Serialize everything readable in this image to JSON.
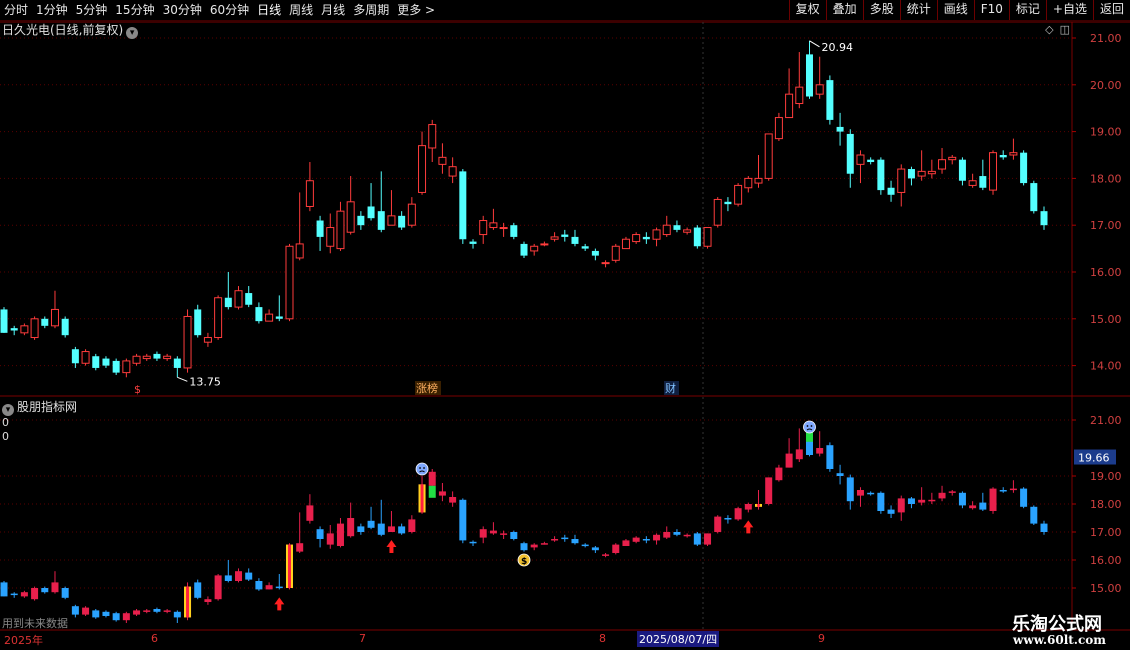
{
  "toolbar": {
    "periods": [
      "分时",
      "1分钟",
      "5分钟",
      "15分钟",
      "30分钟",
      "60分钟",
      "日线",
      "周线",
      "月线",
      "多周期",
      "更多 >"
    ],
    "active_period": "日线",
    "actions": [
      "复权",
      "叠加",
      "多股",
      "统计",
      "画线",
      "F10",
      "标记",
      "+自选",
      "返回"
    ]
  },
  "stock": {
    "title": "日久光电(日线,前复权)"
  },
  "indicator": {
    "title": "股朋指标网"
  },
  "zeros": [
    "0",
    "0"
  ],
  "main_pane": {
    "y_ticks": [
      "21.00",
      "20.00",
      "19.00",
      "18.00",
      "17.00",
      "16.00",
      "15.00",
      "14.00"
    ],
    "high_label": "20.94",
    "low_label": "13.75",
    "markers": [
      "$",
      "涨榜",
      "财"
    ]
  },
  "sub_pane": {
    "y_ticks": [
      "21.00",
      "19.00",
      "18.00",
      "17.00",
      "16.00",
      "15.00"
    ],
    "current_price": "19.66"
  },
  "dates": [
    "2025年",
    "6",
    "7",
    "8",
    "9"
  ],
  "cursor_date": "2025/08/07/四",
  "future_note": "用到未来数据",
  "watermark": {
    "name": "乐淘公式网",
    "url": "www.60lt.com"
  },
  "colors": {
    "up": "#ff3c3c",
    "down": "#54ffff",
    "sub_up": "#e8204c",
    "sub_down": "#2aa3ff",
    "grid": "#5a0000"
  },
  "chart_data": {
    "type": "candlestick",
    "y_range": [
      13.6,
      21.2
    ],
    "candles": [
      [
        15.2,
        14.7,
        15.25,
        14.7
      ],
      [
        14.8,
        14.75,
        14.85,
        14.65
      ],
      [
        14.7,
        14.85,
        14.9,
        14.65
      ],
      [
        14.6,
        15.0,
        15.05,
        14.55
      ],
      [
        15.0,
        14.85,
        15.05,
        14.8
      ],
      [
        14.85,
        15.2,
        15.6,
        14.8
      ],
      [
        15.0,
        14.65,
        15.05,
        14.6
      ],
      [
        14.35,
        14.05,
        14.4,
        13.95
      ],
      [
        14.05,
        14.3,
        14.35,
        14.0
      ],
      [
        14.2,
        13.95,
        14.25,
        13.9
      ],
      [
        14.15,
        14.0,
        14.2,
        13.95
      ],
      [
        14.1,
        13.85,
        14.15,
        13.8
      ],
      [
        13.85,
        14.1,
        14.15,
        13.75
      ],
      [
        14.05,
        14.2,
        14.25,
        14.0
      ],
      [
        14.15,
        14.2,
        14.25,
        14.1
      ],
      [
        14.25,
        14.15,
        14.3,
        14.1
      ],
      [
        14.15,
        14.2,
        14.25,
        14.1
      ],
      [
        14.15,
        13.95,
        14.2,
        13.75
      ],
      [
        13.95,
        15.05,
        15.2,
        13.85
      ],
      [
        15.2,
        14.65,
        15.3,
        14.6
      ],
      [
        14.5,
        14.6,
        14.7,
        14.4
      ],
      [
        14.6,
        15.45,
        15.5,
        14.55
      ],
      [
        15.45,
        15.25,
        16.0,
        15.2
      ],
      [
        15.25,
        15.6,
        15.7,
        15.2
      ],
      [
        15.55,
        15.3,
        15.7,
        15.25
      ],
      [
        15.25,
        14.95,
        15.35,
        14.9
      ],
      [
        14.95,
        15.1,
        15.2,
        14.95
      ],
      [
        15.05,
        15.0,
        15.5,
        14.95
      ],
      [
        15.0,
        16.55,
        16.6,
        14.95
      ],
      [
        16.3,
        16.6,
        17.7,
        16.25
      ],
      [
        17.4,
        17.95,
        18.35,
        17.3
      ],
      [
        17.1,
        16.75,
        17.2,
        16.45
      ],
      [
        16.55,
        16.95,
        17.25,
        16.4
      ],
      [
        16.5,
        17.3,
        17.5,
        16.45
      ],
      [
        16.85,
        17.5,
        18.05,
        16.8
      ],
      [
        17.2,
        17.0,
        17.3,
        16.9
      ],
      [
        17.4,
        17.15,
        17.9,
        17.1
      ],
      [
        17.3,
        16.9,
        18.15,
        16.85
      ],
      [
        17.0,
        17.2,
        17.75,
        17.0
      ],
      [
        17.2,
        16.95,
        17.3,
        16.9
      ],
      [
        17.0,
        17.45,
        17.6,
        16.95
      ],
      [
        17.7,
        18.7,
        19.0,
        17.65
      ],
      [
        18.65,
        19.15,
        19.25,
        18.35
      ],
      [
        18.3,
        18.45,
        18.75,
        18.1
      ],
      [
        18.05,
        18.25,
        18.45,
        17.9
      ],
      [
        18.15,
        16.7,
        18.2,
        16.6
      ],
      [
        16.65,
        16.6,
        16.7,
        16.5
      ],
      [
        16.8,
        17.1,
        17.2,
        16.6
      ],
      [
        16.95,
        17.05,
        17.35,
        16.9
      ],
      [
        16.95,
        16.95,
        17.05,
        16.75
      ],
      [
        17.0,
        16.75,
        17.05,
        16.7
      ],
      [
        16.6,
        16.35,
        16.65,
        16.3
      ],
      [
        16.45,
        16.55,
        16.6,
        16.35
      ],
      [
        16.6,
        16.6,
        16.65,
        16.55
      ],
      [
        16.7,
        16.75,
        16.85,
        16.65
      ],
      [
        16.8,
        16.75,
        16.9,
        16.65
      ],
      [
        16.75,
        16.6,
        16.9,
        16.55
      ],
      [
        16.55,
        16.5,
        16.6,
        16.45
      ],
      [
        16.45,
        16.35,
        16.5,
        16.25
      ],
      [
        16.2,
        16.2,
        16.25,
        16.1
      ],
      [
        16.25,
        16.55,
        16.6,
        16.2
      ],
      [
        16.5,
        16.7,
        16.75,
        16.5
      ],
      [
        16.65,
        16.8,
        16.85,
        16.6
      ],
      [
        16.75,
        16.7,
        16.85,
        16.6
      ],
      [
        16.7,
        16.9,
        16.95,
        16.55
      ],
      [
        16.8,
        17.0,
        17.2,
        16.75
      ],
      [
        17.0,
        16.9,
        17.1,
        16.85
      ],
      [
        16.85,
        16.9,
        16.95,
        16.8
      ],
      [
        16.95,
        16.55,
        17.0,
        16.5
      ],
      [
        16.55,
        16.95,
        16.95,
        16.5
      ],
      [
        17.0,
        17.55,
        17.6,
        16.95
      ],
      [
        17.5,
        17.45,
        17.6,
        17.3
      ],
      [
        17.45,
        17.85,
        17.9,
        17.4
      ],
      [
        17.8,
        18.0,
        18.05,
        17.7
      ],
      [
        17.9,
        18.0,
        18.5,
        17.8
      ],
      [
        18.0,
        18.95,
        18.95,
        17.95
      ],
      [
        18.85,
        19.3,
        19.4,
        18.8
      ],
      [
        19.3,
        19.8,
        20.35,
        19.3
      ],
      [
        19.6,
        19.95,
        20.7,
        19.5
      ],
      [
        20.65,
        19.75,
        20.94,
        19.7
      ],
      [
        19.8,
        20.0,
        20.6,
        19.7
      ],
      [
        20.1,
        19.25,
        20.2,
        19.15
      ],
      [
        19.1,
        19.0,
        19.4,
        18.7
      ],
      [
        18.95,
        18.1,
        19.05,
        17.8
      ],
      [
        18.3,
        18.5,
        18.6,
        17.9
      ],
      [
        18.4,
        18.35,
        18.45,
        18.3
      ],
      [
        18.4,
        17.75,
        18.45,
        17.65
      ],
      [
        17.8,
        17.65,
        17.95,
        17.5
      ],
      [
        17.7,
        18.2,
        18.3,
        17.4
      ],
      [
        18.2,
        18.0,
        18.25,
        17.85
      ],
      [
        18.05,
        18.15,
        18.6,
        17.95
      ],
      [
        18.1,
        18.15,
        18.4,
        18.0
      ],
      [
        18.2,
        18.4,
        18.65,
        18.1
      ],
      [
        18.4,
        18.45,
        18.5,
        18.3
      ],
      [
        18.4,
        17.95,
        18.45,
        17.85
      ],
      [
        17.85,
        17.95,
        18.1,
        17.8
      ],
      [
        18.05,
        17.8,
        18.4,
        17.75
      ],
      [
        17.75,
        18.55,
        18.6,
        17.65
      ],
      [
        18.5,
        18.45,
        18.6,
        18.4
      ],
      [
        18.5,
        18.55,
        18.85,
        18.4
      ],
      [
        18.55,
        17.9,
        18.6,
        17.85
      ],
      [
        17.9,
        17.3,
        17.95,
        17.25
      ],
      [
        17.3,
        17.0,
        17.4,
        16.9
      ]
    ]
  }
}
